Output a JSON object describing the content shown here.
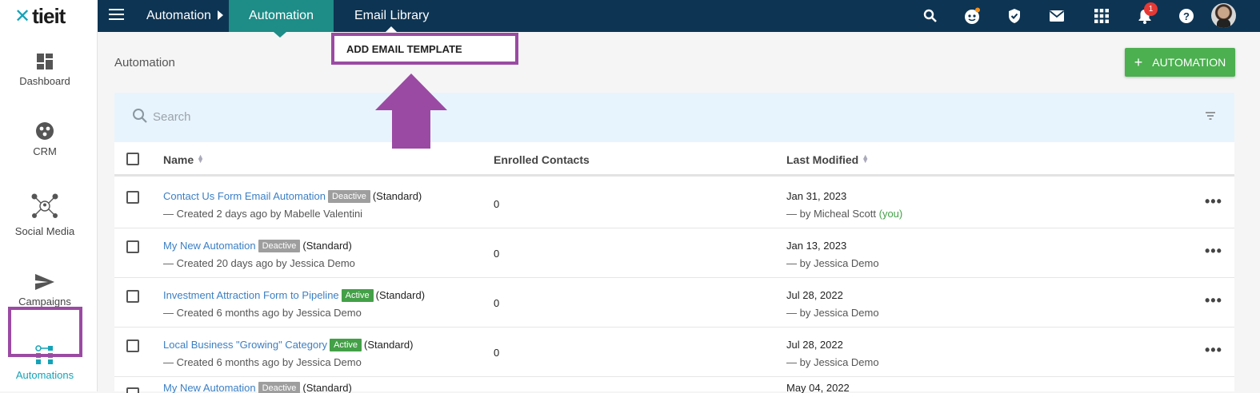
{
  "brand": {
    "logo_text": "tieit",
    "logo_mark": "✕"
  },
  "topbar": {
    "breadcrumb": "Automation",
    "tabs": [
      {
        "label": "Automation",
        "active": true
      },
      {
        "label": "Email Library",
        "active": false
      }
    ],
    "notification_count": "1",
    "icons": [
      "search-icon",
      "assistant-icon",
      "shield-icon",
      "mail-icon",
      "apps-grid-icon",
      "bell-icon",
      "help-icon",
      "user-avatar"
    ]
  },
  "dropdown": {
    "item_label": "ADD EMAIL TEMPLATE"
  },
  "sidebar": {
    "items": [
      {
        "label": "Dashboard",
        "icon": "dashboard-icon"
      },
      {
        "label": "CRM",
        "icon": "crm-icon"
      },
      {
        "label": "Social Media",
        "icon": "social-media-icon"
      },
      {
        "label": "Campaigns",
        "icon": "send-icon"
      },
      {
        "label": "Automations",
        "icon": "automation-icon",
        "active": true
      }
    ]
  },
  "page": {
    "title": "Automation",
    "add_button": "AUTOMATION",
    "add_button_icon": "+"
  },
  "search": {
    "placeholder": "Search"
  },
  "table": {
    "headers": {
      "name": "Name",
      "enrolled": "Enrolled Contacts",
      "modified": "Last Modified"
    },
    "rows": [
      {
        "name": "Contact Us Form Email Automation",
        "status": "Deactive",
        "type": "(Standard)",
        "created": "— Created 2 days ago by Mabelle Valentini",
        "enrolled": "0",
        "date": "Jan 31, 2023",
        "by": "— by Micheal Scott",
        "you": "(you)"
      },
      {
        "name": "My New Automation",
        "status": "Deactive",
        "type": "(Standard)",
        "created": "— Created 20 days ago by Jessica Demo",
        "enrolled": "0",
        "date": "Jan 13, 2023",
        "by": "— by Jessica Demo",
        "you": ""
      },
      {
        "name": "Investment Attraction Form to Pipeline",
        "status": "Active",
        "type": "(Standard)",
        "created": "— Created 6 months ago by Jessica Demo",
        "enrolled": "0",
        "date": "Jul 28, 2022",
        "by": "— by Jessica Demo",
        "you": ""
      },
      {
        "name": "Local Business \"Growing\" Category",
        "status": "Active",
        "type": "(Standard)",
        "created": "— Created 6 months ago by Jessica Demo",
        "enrolled": "0",
        "date": "Jul 28, 2022",
        "by": "— by Jessica Demo",
        "you": ""
      },
      {
        "name": "My New Automation",
        "status": "Deactive",
        "type": "(Standard)",
        "created": "",
        "enrolled": "",
        "date": "May 04, 2022",
        "by": "",
        "you": ""
      }
    ],
    "row_menu": "•••"
  },
  "colors": {
    "topbar": "#0d3453",
    "active_tab": "#1e8c87",
    "accent_teal": "#14a3b8",
    "highlight": "#9b4aa3",
    "add_button": "#4caf50",
    "link": "#3b7fc4"
  }
}
